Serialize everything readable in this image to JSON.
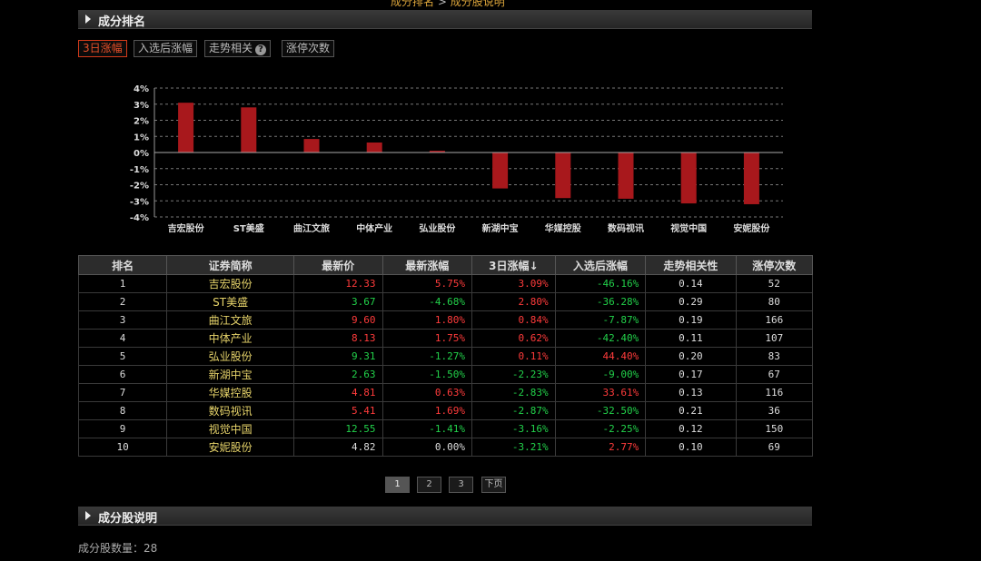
{
  "top_cut": {
    "link": "成分排名",
    "sep": " > ",
    "rest": "成分股说明"
  },
  "section_ranking": {
    "title": "成分排名"
  },
  "tabs": [
    {
      "label": "3日涨幅",
      "active": true
    },
    {
      "label": "入选后涨幅",
      "active": false
    },
    {
      "label": "走势相关",
      "active": false,
      "help": "?"
    },
    {
      "label": "涨停次数",
      "active": false
    }
  ],
  "colors": {
    "bar": "#a8181c",
    "up": "#ff3b3b",
    "down": "#22d14a",
    "stock_name": "#e6d36a"
  },
  "chart_data": {
    "type": "bar",
    "categories": [
      "吉宏股份",
      "ST美盛",
      "曲江文旅",
      "中体产业",
      "弘业股份",
      "新湖中宝",
      "华媒控股",
      "数码视讯",
      "视觉中国",
      "安妮股份"
    ],
    "values": [
      3.09,
      2.8,
      0.84,
      0.62,
      0.11,
      -2.23,
      -2.83,
      -2.87,
      -3.16,
      -3.21
    ],
    "ylim": [
      -4,
      4
    ],
    "yticks": [
      "4%",
      "3%",
      "2%",
      "1%",
      "0%",
      "-1%",
      "-2%",
      "-3%",
      "-4%"
    ],
    "grid": true
  },
  "table": {
    "headers": [
      "排名",
      "证券简称",
      "最新价",
      "最新涨幅",
      "3日涨幅",
      "入选后涨幅",
      "走势相关性",
      "涨停次数"
    ],
    "sort_arrow": "↓",
    "rows": [
      {
        "rank": "1",
        "name": "吉宏股份",
        "price": "12.33",
        "chg": "5.75%",
        "chg3": "3.09%",
        "since": "-46.16%",
        "corr": "0.14",
        "limit": "52",
        "pc": "up",
        "cc": "up",
        "c3": "up",
        "sc": "down"
      },
      {
        "rank": "2",
        "name": "ST美盛",
        "price": "3.67",
        "chg": "-4.68%",
        "chg3": "2.80%",
        "since": "-36.28%",
        "corr": "0.29",
        "limit": "80",
        "pc": "down",
        "cc": "down",
        "c3": "up",
        "sc": "down"
      },
      {
        "rank": "3",
        "name": "曲江文旅",
        "price": "9.60",
        "chg": "1.80%",
        "chg3": "0.84%",
        "since": "-7.87%",
        "corr": "0.19",
        "limit": "166",
        "pc": "up",
        "cc": "up",
        "c3": "up",
        "sc": "down"
      },
      {
        "rank": "4",
        "name": "中体产业",
        "price": "8.13",
        "chg": "1.75%",
        "chg3": "0.62%",
        "since": "-42.40%",
        "corr": "0.11",
        "limit": "107",
        "pc": "up",
        "cc": "up",
        "c3": "up",
        "sc": "down"
      },
      {
        "rank": "5",
        "name": "弘业股份",
        "price": "9.31",
        "chg": "-1.27%",
        "chg3": "0.11%",
        "since": "44.40%",
        "corr": "0.20",
        "limit": "83",
        "pc": "down",
        "cc": "down",
        "c3": "up",
        "sc": "up"
      },
      {
        "rank": "6",
        "name": "新湖中宝",
        "price": "2.63",
        "chg": "-1.50%",
        "chg3": "-2.23%",
        "since": "-9.00%",
        "corr": "0.17",
        "limit": "67",
        "pc": "down",
        "cc": "down",
        "c3": "down",
        "sc": "down"
      },
      {
        "rank": "7",
        "name": "华媒控股",
        "price": "4.81",
        "chg": "0.63%",
        "chg3": "-2.83%",
        "since": "33.61%",
        "corr": "0.13",
        "limit": "116",
        "pc": "up",
        "cc": "up",
        "c3": "down",
        "sc": "up"
      },
      {
        "rank": "8",
        "name": "数码视讯",
        "price": "5.41",
        "chg": "1.69%",
        "chg3": "-2.87%",
        "since": "-32.50%",
        "corr": "0.21",
        "limit": "36",
        "pc": "up",
        "cc": "up",
        "c3": "down",
        "sc": "down"
      },
      {
        "rank": "9",
        "name": "视觉中国",
        "price": "12.55",
        "chg": "-1.41%",
        "chg3": "-3.16%",
        "since": "-2.25%",
        "corr": "0.12",
        "limit": "150",
        "pc": "down",
        "cc": "down",
        "c3": "down",
        "sc": "down"
      },
      {
        "rank": "10",
        "name": "安妮股份",
        "price": "4.82",
        "chg": "0.00%",
        "chg3": "-3.21%",
        "since": "2.77%",
        "corr": "0.10",
        "limit": "69",
        "pc": "flat",
        "cc": "flat",
        "c3": "down",
        "sc": "up"
      }
    ]
  },
  "pager": {
    "pages": [
      "1",
      "2",
      "3"
    ],
    "next": "下页",
    "current": "1"
  },
  "section_desc": {
    "title": "成分股说明"
  },
  "stock_count": {
    "label": "成分股数量：",
    "value": "28"
  }
}
